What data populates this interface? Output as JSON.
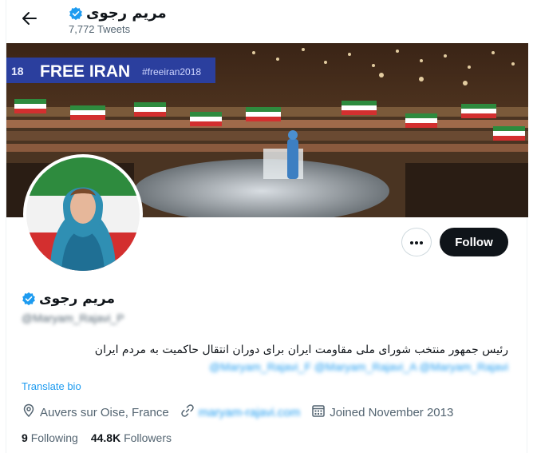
{
  "header": {
    "title": "مریم رجوی",
    "tweet_count": "7,772 Tweets"
  },
  "banner": {
    "sign_left": "18",
    "sign_main": "FREE IRAN",
    "sign_hashtag": "#freeiran2018"
  },
  "actions": {
    "follow_label": "Follow"
  },
  "profile": {
    "display_name": "مریم رجوی",
    "handle": "@Maryam_Rajavi_P",
    "bio": "رئیس جمهور منتخب شورای ملی مقاومت ایران برای دوران انتقال حاکمیت به مردم ایران",
    "bio_mentions": "@Maryam_Rajavi_F @Maryam_Rajavi_A @Maryam_Rajavi",
    "translate_label": "Translate bio",
    "location": "Auvers sur Oise, France",
    "website": "maryam-rajavi.com",
    "joined": "Joined November 2013",
    "following_count": "9",
    "following_label": "Following",
    "followers_count": "44.8K",
    "followers_label": "Followers"
  },
  "colors": {
    "accent": "#1d9bf0",
    "follow_bg": "#0f1419",
    "muted": "#536471",
    "border": "#cfd9de"
  },
  "icons": {
    "back": "arrow-left-icon",
    "verified": "verified-badge-icon",
    "more": "ellipsis-icon",
    "location": "location-pin-icon",
    "link": "link-icon",
    "calendar": "calendar-icon"
  }
}
